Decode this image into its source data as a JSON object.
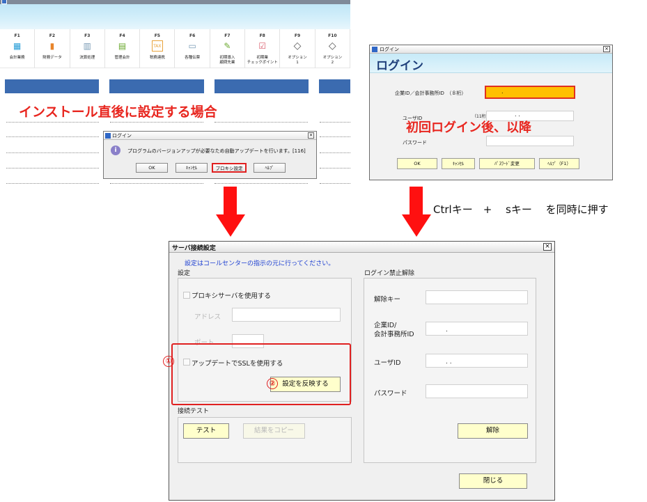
{
  "app": {
    "fkeys": [
      {
        "key": "F1",
        "icon": "calculator-icon",
        "glyph": "▦",
        "label": "会計業務"
      },
      {
        "key": "F2",
        "icon": "bar-chart-icon",
        "glyph": "▮",
        "label": "財務データ"
      },
      {
        "key": "F3",
        "icon": "books-icon",
        "glyph": "▥",
        "label": "決算処理"
      },
      {
        "key": "F4",
        "icon": "ledger-icon",
        "glyph": "▤",
        "label": "管理会計"
      },
      {
        "key": "F5",
        "icon": "tax-icon",
        "glyph": "TAX",
        "label": "税務連携"
      },
      {
        "key": "F6",
        "icon": "slip-icon",
        "glyph": "▭",
        "label": "各種伝票"
      },
      {
        "key": "F7",
        "icon": "setup-icon",
        "glyph": "✎",
        "label": "初期導入\n顧問先業"
      },
      {
        "key": "F8",
        "icon": "checkpoint-icon",
        "glyph": "☑",
        "label": "初期業\nチェックポイント"
      },
      {
        "key": "F9",
        "icon": "diamond-icon",
        "glyph": "◇",
        "label": "オプション\n1"
      },
      {
        "key": "F10",
        "icon": "diamond-icon",
        "glyph": "◇",
        "label": "オプション\n2"
      }
    ],
    "annotation": "インストール直後に設定する場合"
  },
  "mini_dialog": {
    "title": "ログイン",
    "close": "×",
    "info_glyph": "i",
    "message": "プログラムのバージョンアップが必要なため自動アップデートを行います。[116]",
    "buttons": {
      "ok": "OK",
      "cancel": "ｷｬﾝｾﾙ",
      "proxy": "プロキシ設定",
      "help": "ﾍﾙﾌﾟ"
    }
  },
  "login_dialog": {
    "title": "ログイン",
    "close": "×",
    "heading": "ログイン",
    "company_label": "企業ID／会計事務所ID　（８桁）",
    "company_value": ".",
    "user_label": "ユーザID",
    "user_hint": "（11桁）",
    "user_value": ".    .",
    "password_label": "パスワード",
    "annotation": "初回ログイン後、以降",
    "buttons": {
      "ok": "OK",
      "cancel": "ｷｬﾝｾﾙ",
      "change_password": "ﾊﾟｽﾜｰﾄﾞ変更",
      "help": "ﾍﾙﾌﾟ（F1）"
    }
  },
  "instruction": "Ctrlキー　+　 sキー　 を同時に押す",
  "server_dialog": {
    "title": "サーバ接続設定",
    "close": "×",
    "note": "設定はコールセンターの指示の元に行ってください。",
    "settings": {
      "section_label": "設定",
      "use_proxy_label": "プロキシサーバを使用する",
      "address_label": "アドレス",
      "port_label": "ポート",
      "use_ssl_label": "アップデートでSSLを使用する",
      "apply_button": "設定を反映する"
    },
    "connection_test": {
      "section_label": "接続テスト",
      "test_button": "テスト",
      "copy_button": "結果をコピー"
    },
    "unlock": {
      "section_label": "ログイン禁止解除",
      "unlock_key_label": "解除キー",
      "company_label_1": "企業ID/",
      "company_label_2": "会計事務所ID",
      "company_value": ".",
      "user_label": "ユーザID",
      "user_value": ".    .",
      "password_label": "パスワード",
      "unlock_button": "解除"
    },
    "close_button": "閉じる",
    "markers": {
      "one": "①",
      "two": "②"
    }
  },
  "colors": {
    "accent_red": "#e8261f",
    "note_blue": "#1d3fd1",
    "button_yellow": "#ffffcc",
    "highlight_orange": "#ffc000"
  }
}
